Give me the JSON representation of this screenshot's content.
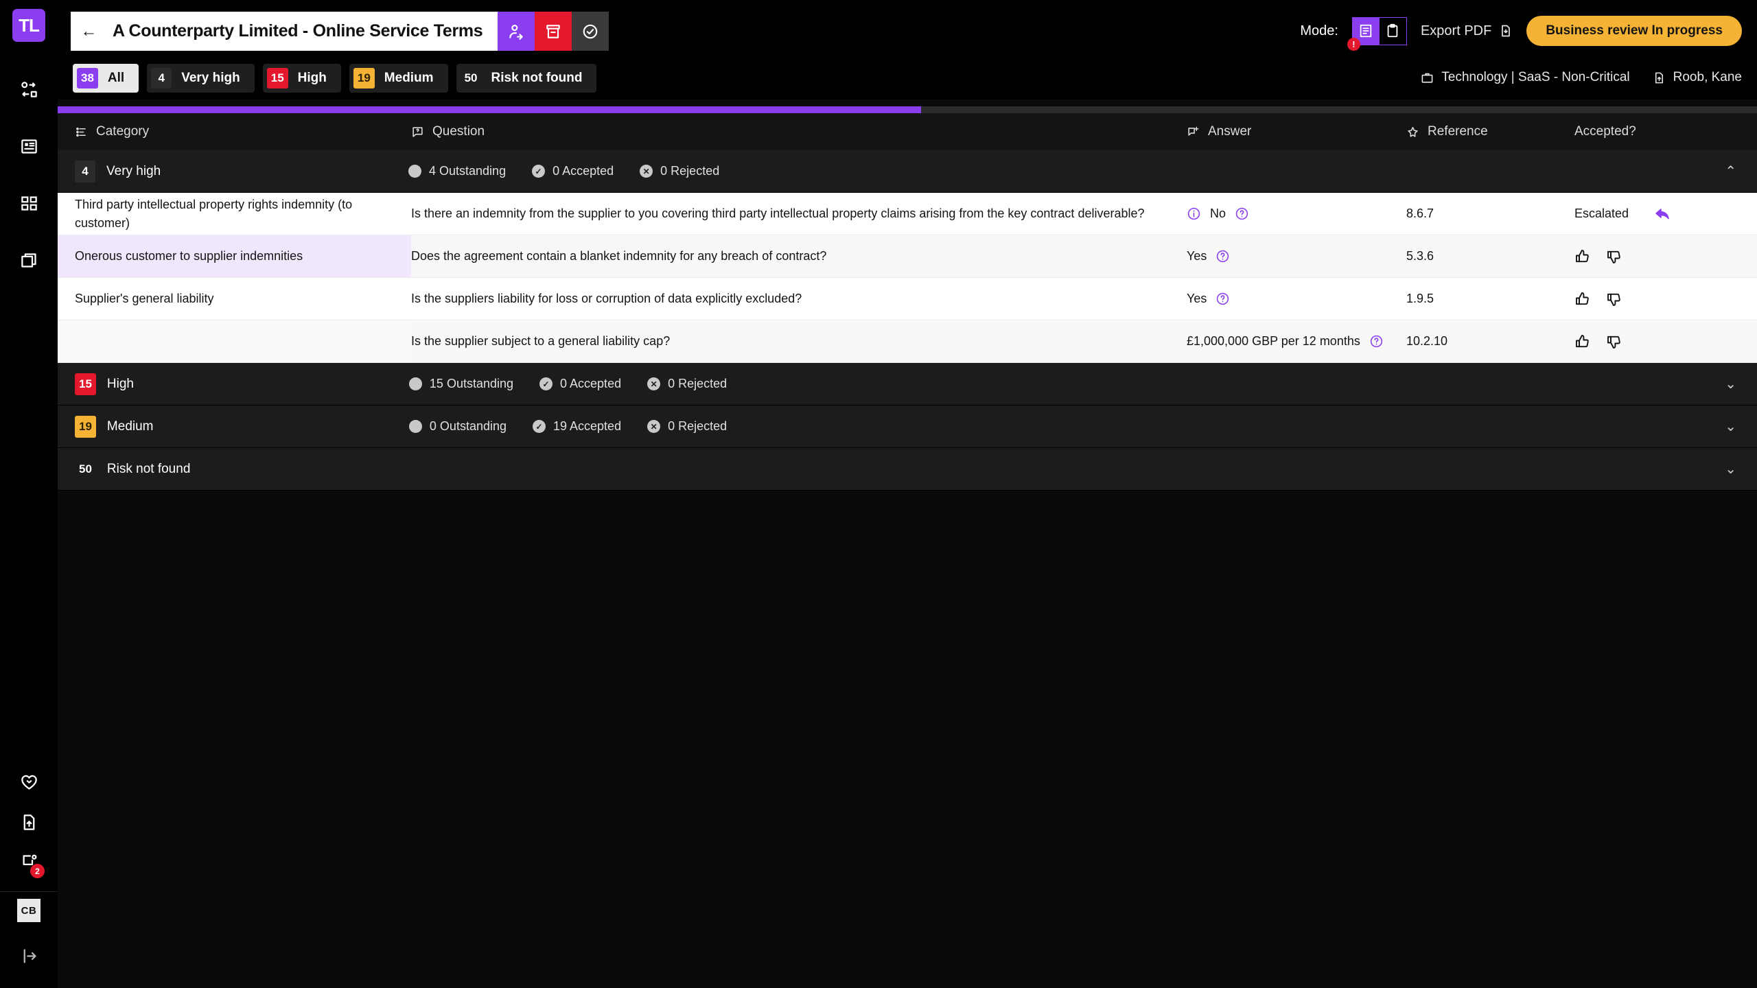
{
  "app": {
    "logo_text": "TL"
  },
  "sidebar": {
    "top_items": [
      {
        "name": "workflow-icon",
        "label": "Workflow"
      },
      {
        "name": "contract-icon",
        "label": "Contracts"
      },
      {
        "name": "dashboard-icon",
        "label": "Dashboard"
      },
      {
        "name": "playbooks-icon",
        "label": "Playbooks"
      }
    ],
    "bottom_items": [
      {
        "name": "favourites-icon",
        "label": "Favourites"
      },
      {
        "name": "upload-icon",
        "label": "Upload"
      },
      {
        "name": "notifications-icon",
        "label": "Notifications",
        "badge": "2"
      }
    ],
    "avatar_initials": "CB",
    "logout_label": "Log out"
  },
  "header": {
    "back_label": "←",
    "title": "A Counterparty Limited - Online Service Terms",
    "actions": [
      {
        "name": "share-user-button",
        "label": "Share"
      },
      {
        "name": "archive-button",
        "label": "Archive"
      },
      {
        "name": "approve-button",
        "label": "Approve"
      }
    ],
    "mode_label": "Mode:",
    "mode_options": [
      {
        "name": "mode-report-button",
        "label": "Report view",
        "active": true,
        "alert": "!"
      },
      {
        "name": "mode-checklist-button",
        "label": "Checklist view",
        "active": false
      }
    ],
    "export_label": "Export PDF",
    "status_label": "Business review In progress"
  },
  "filters": {
    "chips": [
      {
        "count": "38",
        "label": "All",
        "style": "all",
        "active": true
      },
      {
        "count": "4",
        "label": "Very high",
        "style": "vhigh",
        "active": false
      },
      {
        "count": "15",
        "label": "High",
        "style": "high",
        "active": false
      },
      {
        "count": "19",
        "label": "Medium",
        "style": "med",
        "active": false
      },
      {
        "count": "50",
        "label": "Risk not found",
        "style": "none",
        "active": false
      }
    ],
    "meta": [
      {
        "icon": "briefcase-icon",
        "text": "Technology | SaaS - Non-Critical"
      },
      {
        "icon": "file-upload-icon",
        "text": "Roob, Kane"
      }
    ]
  },
  "progress": {
    "percent": 50.8
  },
  "table": {
    "columns": [
      {
        "label": "Category",
        "icon": "list-settings-icon"
      },
      {
        "label": "Question",
        "icon": "question-bubble-icon"
      },
      {
        "label": "Answer",
        "icon": "message-plus-icon"
      },
      {
        "label": "Reference",
        "icon": "pin-icon"
      },
      {
        "label": "Accepted?",
        "icon": ""
      }
    ],
    "groups": [
      {
        "count": "4",
        "label": "Very high",
        "style": "vhigh",
        "expanded": true,
        "outstanding": "4 Outstanding",
        "accepted": "0 Accepted",
        "rejected": "0 Rejected",
        "rows": [
          {
            "category": "Third party intellectual property rights indemnity (to customer)",
            "category_style": "plain",
            "question": "Is there an indemnity from the supplier to you covering third party intellectual property claims arising from the key contract deliverable?",
            "answer": "No",
            "has_info_icon": true,
            "has_help_icon": true,
            "reference": "8.6.7",
            "accepted_text": "Escalated",
            "accepted_control": "escalated"
          },
          {
            "category": "Onerous customer to supplier indemnities",
            "category_style": "highlight",
            "question": "Does the agreement contain a blanket indemnity for any breach of contract?",
            "answer": "Yes",
            "has_info_icon": false,
            "has_help_icon": true,
            "reference": "5.3.6",
            "accepted_text": "",
            "accepted_control": "thumbs"
          },
          {
            "category": "Supplier's general liability",
            "category_style": "plain",
            "question": "Is the suppliers liability for loss or corruption of data explicitly excluded?",
            "answer": "Yes",
            "has_info_icon": false,
            "has_help_icon": true,
            "reference": "1.9.5",
            "accepted_text": "",
            "accepted_control": "thumbs"
          },
          {
            "category": "",
            "category_style": "blank",
            "question": "Is the supplier subject to a general liability cap?",
            "answer": "£1,000,000 GBP per 12 months",
            "has_info_icon": false,
            "has_help_icon": true,
            "reference": "10.2.10",
            "accepted_text": "",
            "accepted_control": "thumbs"
          }
        ]
      },
      {
        "count": "15",
        "label": "High",
        "style": "high",
        "expanded": false,
        "outstanding": "15 Outstanding",
        "accepted": "0 Accepted",
        "rejected": "0 Rejected",
        "rows": []
      },
      {
        "count": "19",
        "label": "Medium",
        "style": "med",
        "expanded": false,
        "outstanding": "0 Outstanding",
        "accepted": "19 Accepted",
        "rejected": "0 Rejected",
        "rows": []
      },
      {
        "count": "50",
        "label": "Risk not found",
        "style": "none",
        "expanded": false,
        "outstanding": "",
        "accepted": "",
        "rejected": "",
        "rows": []
      }
    ]
  },
  "colors": {
    "accent_purple": "#8b3df0",
    "danger_red": "#e3182d",
    "warning_amber": "#f5b335",
    "background_dark": "#000000"
  }
}
